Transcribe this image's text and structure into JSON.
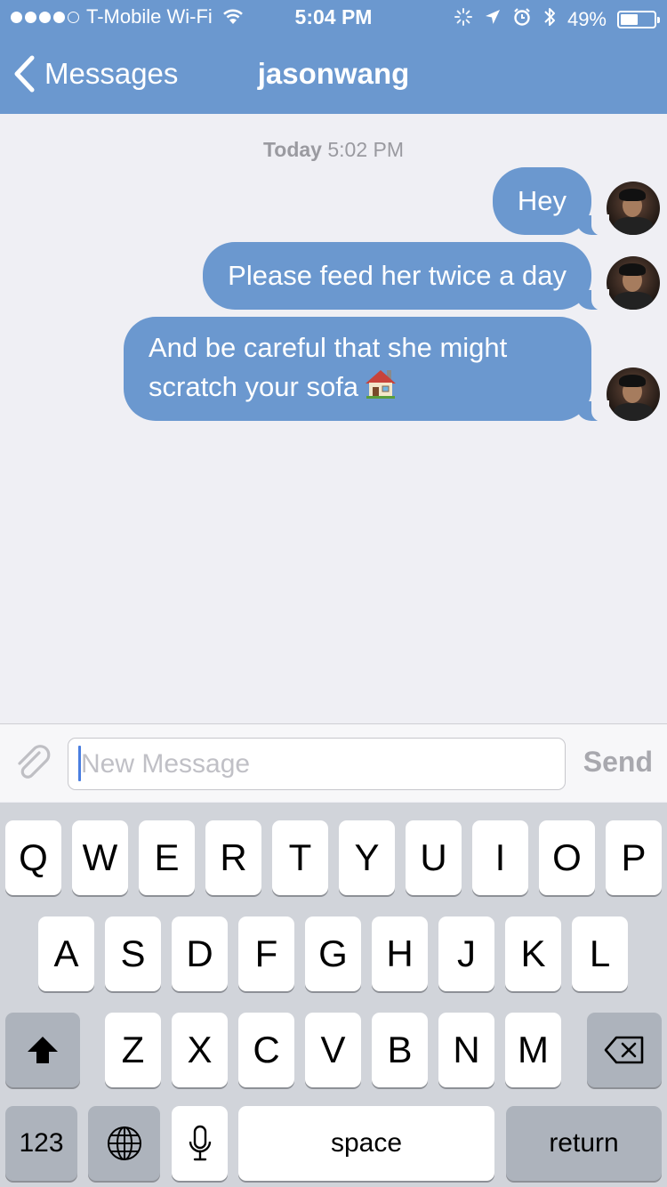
{
  "status_bar": {
    "carrier": "T-Mobile Wi-Fi",
    "time": "5:04 PM",
    "battery": "49%"
  },
  "nav": {
    "back_label": "Messages",
    "title": "jasonwang"
  },
  "conversation": {
    "timestamp_day": "Today",
    "timestamp_time": "5:02 PM",
    "messages": [
      {
        "text": "Hey",
        "sender": "me"
      },
      {
        "text": "Please feed her twice a day",
        "sender": "me"
      },
      {
        "text": "And be careful that she might scratch your sofa",
        "sender": "me",
        "emoji": "house-icon"
      }
    ]
  },
  "composer": {
    "placeholder": "New Message",
    "value": "",
    "send_label": "Send"
  },
  "keyboard": {
    "row1": [
      "Q",
      "W",
      "E",
      "R",
      "T",
      "Y",
      "U",
      "I",
      "O",
      "P"
    ],
    "row2": [
      "A",
      "S",
      "D",
      "F",
      "G",
      "H",
      "J",
      "K",
      "L"
    ],
    "row3": [
      "Z",
      "X",
      "C",
      "V",
      "B",
      "N",
      "M"
    ],
    "numbers_label": "123",
    "space_label": "space",
    "return_label": "return"
  },
  "colors": {
    "accent": "#6b98cf",
    "background": "#efeff4",
    "keyboard_bg": "#d1d4da",
    "dark_key": "#adb3bc"
  }
}
